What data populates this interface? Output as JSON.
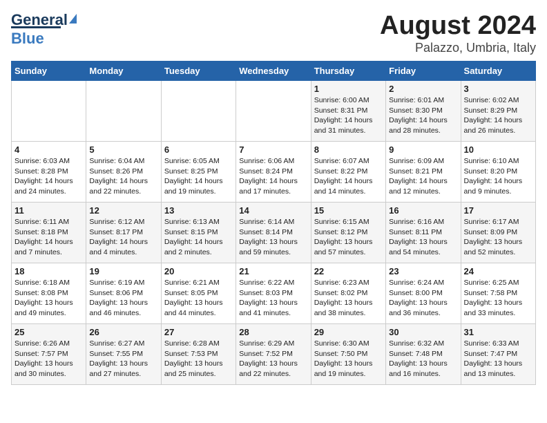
{
  "header": {
    "logo_line1": "General",
    "logo_line2": "Blue",
    "main_title": "August 2024",
    "subtitle": "Palazzo, Umbria, Italy"
  },
  "days_of_week": [
    "Sunday",
    "Monday",
    "Tuesday",
    "Wednesday",
    "Thursday",
    "Friday",
    "Saturday"
  ],
  "weeks": [
    [
      {
        "day": "",
        "content": ""
      },
      {
        "day": "",
        "content": ""
      },
      {
        "day": "",
        "content": ""
      },
      {
        "day": "",
        "content": ""
      },
      {
        "day": "1",
        "content": "Sunrise: 6:00 AM\nSunset: 8:31 PM\nDaylight: 14 hours\nand 31 minutes."
      },
      {
        "day": "2",
        "content": "Sunrise: 6:01 AM\nSunset: 8:30 PM\nDaylight: 14 hours\nand 28 minutes."
      },
      {
        "day": "3",
        "content": "Sunrise: 6:02 AM\nSunset: 8:29 PM\nDaylight: 14 hours\nand 26 minutes."
      }
    ],
    [
      {
        "day": "4",
        "content": "Sunrise: 6:03 AM\nSunset: 8:28 PM\nDaylight: 14 hours\nand 24 minutes."
      },
      {
        "day": "5",
        "content": "Sunrise: 6:04 AM\nSunset: 8:26 PM\nDaylight: 14 hours\nand 22 minutes."
      },
      {
        "day": "6",
        "content": "Sunrise: 6:05 AM\nSunset: 8:25 PM\nDaylight: 14 hours\nand 19 minutes."
      },
      {
        "day": "7",
        "content": "Sunrise: 6:06 AM\nSunset: 8:24 PM\nDaylight: 14 hours\nand 17 minutes."
      },
      {
        "day": "8",
        "content": "Sunrise: 6:07 AM\nSunset: 8:22 PM\nDaylight: 14 hours\nand 14 minutes."
      },
      {
        "day": "9",
        "content": "Sunrise: 6:09 AM\nSunset: 8:21 PM\nDaylight: 14 hours\nand 12 minutes."
      },
      {
        "day": "10",
        "content": "Sunrise: 6:10 AM\nSunset: 8:20 PM\nDaylight: 14 hours\nand 9 minutes."
      }
    ],
    [
      {
        "day": "11",
        "content": "Sunrise: 6:11 AM\nSunset: 8:18 PM\nDaylight: 14 hours\nand 7 minutes."
      },
      {
        "day": "12",
        "content": "Sunrise: 6:12 AM\nSunset: 8:17 PM\nDaylight: 14 hours\nand 4 minutes."
      },
      {
        "day": "13",
        "content": "Sunrise: 6:13 AM\nSunset: 8:15 PM\nDaylight: 14 hours\nand 2 minutes."
      },
      {
        "day": "14",
        "content": "Sunrise: 6:14 AM\nSunset: 8:14 PM\nDaylight: 13 hours\nand 59 minutes."
      },
      {
        "day": "15",
        "content": "Sunrise: 6:15 AM\nSunset: 8:12 PM\nDaylight: 13 hours\nand 57 minutes."
      },
      {
        "day": "16",
        "content": "Sunrise: 6:16 AM\nSunset: 8:11 PM\nDaylight: 13 hours\nand 54 minutes."
      },
      {
        "day": "17",
        "content": "Sunrise: 6:17 AM\nSunset: 8:09 PM\nDaylight: 13 hours\nand 52 minutes."
      }
    ],
    [
      {
        "day": "18",
        "content": "Sunrise: 6:18 AM\nSunset: 8:08 PM\nDaylight: 13 hours\nand 49 minutes."
      },
      {
        "day": "19",
        "content": "Sunrise: 6:19 AM\nSunset: 8:06 PM\nDaylight: 13 hours\nand 46 minutes."
      },
      {
        "day": "20",
        "content": "Sunrise: 6:21 AM\nSunset: 8:05 PM\nDaylight: 13 hours\nand 44 minutes."
      },
      {
        "day": "21",
        "content": "Sunrise: 6:22 AM\nSunset: 8:03 PM\nDaylight: 13 hours\nand 41 minutes."
      },
      {
        "day": "22",
        "content": "Sunrise: 6:23 AM\nSunset: 8:02 PM\nDaylight: 13 hours\nand 38 minutes."
      },
      {
        "day": "23",
        "content": "Sunrise: 6:24 AM\nSunset: 8:00 PM\nDaylight: 13 hours\nand 36 minutes."
      },
      {
        "day": "24",
        "content": "Sunrise: 6:25 AM\nSunset: 7:58 PM\nDaylight: 13 hours\nand 33 minutes."
      }
    ],
    [
      {
        "day": "25",
        "content": "Sunrise: 6:26 AM\nSunset: 7:57 PM\nDaylight: 13 hours\nand 30 minutes."
      },
      {
        "day": "26",
        "content": "Sunrise: 6:27 AM\nSunset: 7:55 PM\nDaylight: 13 hours\nand 27 minutes."
      },
      {
        "day": "27",
        "content": "Sunrise: 6:28 AM\nSunset: 7:53 PM\nDaylight: 13 hours\nand 25 minutes."
      },
      {
        "day": "28",
        "content": "Sunrise: 6:29 AM\nSunset: 7:52 PM\nDaylight: 13 hours\nand 22 minutes."
      },
      {
        "day": "29",
        "content": "Sunrise: 6:30 AM\nSunset: 7:50 PM\nDaylight: 13 hours\nand 19 minutes."
      },
      {
        "day": "30",
        "content": "Sunrise: 6:32 AM\nSunset: 7:48 PM\nDaylight: 13 hours\nand 16 minutes."
      },
      {
        "day": "31",
        "content": "Sunrise: 6:33 AM\nSunset: 7:47 PM\nDaylight: 13 hours\nand 13 minutes."
      }
    ]
  ]
}
